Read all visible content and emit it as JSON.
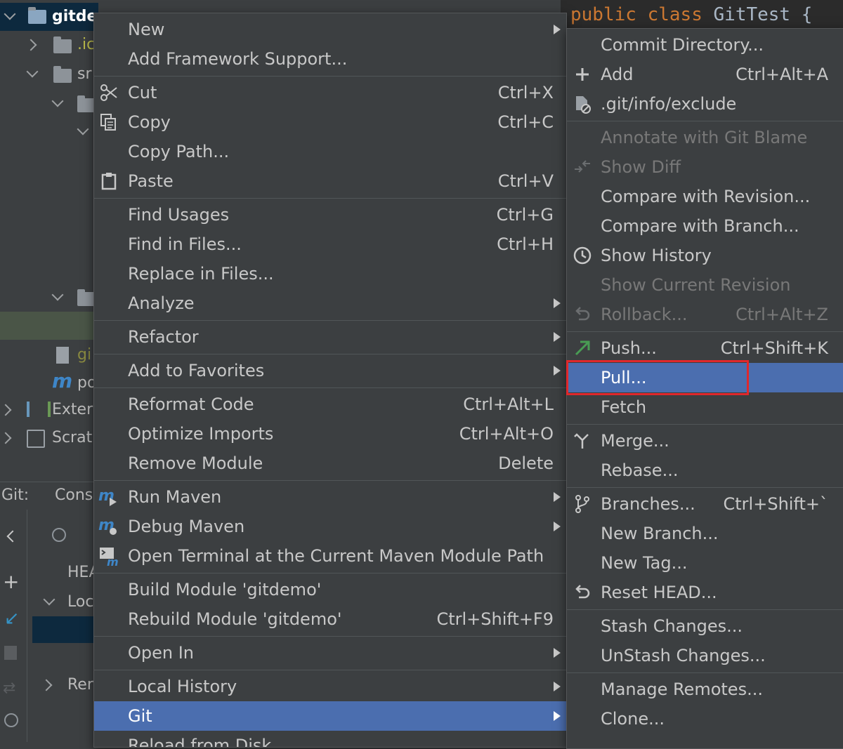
{
  "tree": {
    "root": "gitde",
    "row1": ".ic",
    "row2": "sr",
    "row_gi": "gi",
    "row_po": "po",
    "exter": "Exter",
    "scrat": "Scrat"
  },
  "git_panel": {
    "label": "Git:",
    "cons": "Cons",
    "head": "HEA",
    "loc": "Loc",
    "rer": "Rer"
  },
  "editor": {
    "code_public": "public",
    "code_class": "class",
    "code_name": "GitTest {"
  },
  "context_menu": {
    "items": [
      {
        "label": "New",
        "shortcut": "",
        "submenu": true
      },
      {
        "label": "Add Framework Support...",
        "shortcut": ""
      },
      {
        "label": "Cut",
        "shortcut": "Ctrl+X",
        "icon": "scissors-icon"
      },
      {
        "label": "Copy",
        "shortcut": "Ctrl+C",
        "icon": "copy-icon"
      },
      {
        "label": "Copy Path...",
        "shortcut": ""
      },
      {
        "label": "Paste",
        "shortcut": "Ctrl+V",
        "icon": "clipboard-icon"
      },
      {
        "label": "Find Usages",
        "shortcut": "Ctrl+G"
      },
      {
        "label": "Find in Files...",
        "shortcut": "Ctrl+H"
      },
      {
        "label": "Replace in Files...",
        "shortcut": ""
      },
      {
        "label": "Analyze",
        "shortcut": "",
        "submenu": true
      },
      {
        "label": "Refactor",
        "shortcut": "",
        "submenu": true
      },
      {
        "label": "Add to Favorites",
        "shortcut": "",
        "submenu": true
      },
      {
        "label": "Reformat Code",
        "shortcut": "Ctrl+Alt+L"
      },
      {
        "label": "Optimize Imports",
        "shortcut": "Ctrl+Alt+O"
      },
      {
        "label": "Remove Module",
        "shortcut": "Delete"
      },
      {
        "label": "Run Maven",
        "shortcut": "",
        "submenu": true,
        "icon": "maven-run-icon"
      },
      {
        "label": "Debug Maven",
        "shortcut": "",
        "submenu": true,
        "icon": "maven-debug-icon"
      },
      {
        "label": "Open Terminal at the Current Maven Module Path",
        "shortcut": "",
        "icon": "terminal-maven-icon"
      },
      {
        "label": "Build Module 'gitdemo'",
        "shortcut": ""
      },
      {
        "label": "Rebuild Module 'gitdemo'",
        "shortcut": "Ctrl+Shift+F9"
      },
      {
        "label": "Open In",
        "shortcut": "",
        "submenu": true
      },
      {
        "label": "Local History",
        "shortcut": "",
        "submenu": true
      },
      {
        "label": "Git",
        "shortcut": "",
        "submenu": true,
        "selected": true
      },
      {
        "label": "Reload from Disk",
        "shortcut": ""
      }
    ]
  },
  "git_submenu": {
    "items": [
      {
        "label": "Commit Directory...",
        "shortcut": ""
      },
      {
        "label": "Add",
        "shortcut": "Ctrl+Alt+A",
        "icon": "plus-icon"
      },
      {
        "label": ".git/info/exclude",
        "shortcut": "",
        "icon": "ignore-file-icon"
      },
      {
        "label": "Annotate with Git Blame",
        "shortcut": "",
        "disabled": true
      },
      {
        "label": "Show Diff",
        "shortcut": "",
        "disabled": true,
        "icon": "diff-icon"
      },
      {
        "label": "Compare with Revision...",
        "shortcut": ""
      },
      {
        "label": "Compare with Branch...",
        "shortcut": ""
      },
      {
        "label": "Show History",
        "shortcut": "",
        "icon": "clock-icon"
      },
      {
        "label": "Show Current Revision",
        "shortcut": "",
        "disabled": true
      },
      {
        "label": "Rollback...",
        "shortcut": "Ctrl+Alt+Z",
        "disabled": true,
        "icon": "rollback-icon"
      },
      {
        "label": "Push...",
        "shortcut": "Ctrl+Shift+K",
        "icon": "push-arrow-icon"
      },
      {
        "label": "Pull...",
        "shortcut": "",
        "selected": true,
        "highlighted": true
      },
      {
        "label": "Fetch",
        "shortcut": ""
      },
      {
        "label": "Merge...",
        "shortcut": "",
        "icon": "merge-icon"
      },
      {
        "label": "Rebase...",
        "shortcut": ""
      },
      {
        "label": "Branches...",
        "shortcut": "Ctrl+Shift+`",
        "icon": "branch-icon"
      },
      {
        "label": "New Branch...",
        "shortcut": ""
      },
      {
        "label": "New Tag...",
        "shortcut": ""
      },
      {
        "label": "Reset HEAD...",
        "shortcut": "",
        "icon": "reset-icon"
      },
      {
        "label": "Stash Changes...",
        "shortcut": ""
      },
      {
        "label": "UnStash Changes...",
        "shortcut": ""
      },
      {
        "label": "Manage Remotes...",
        "shortcut": ""
      },
      {
        "label": "Clone...",
        "shortcut": ""
      }
    ]
  },
  "colors": {
    "background": "#3c3f41",
    "selection": "#4b6eaf",
    "highlight_box": "#e0282c",
    "editor_bg": "#2b2b2b",
    "keyword": "#cc7832"
  }
}
